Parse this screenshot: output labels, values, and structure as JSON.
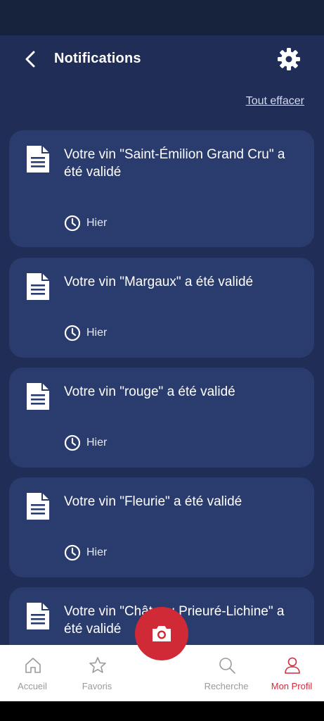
{
  "header": {
    "title": "Notifications",
    "back_icon": "chevron-left-icon",
    "settings_icon": "gear-icon"
  },
  "actions": {
    "clear_all": "Tout effacer"
  },
  "notifications": [
    {
      "message": "Votre vin \"Saint-Émilion Grand Cru\" a été validé",
      "time": "Hier",
      "icon": "document-icon"
    },
    {
      "message": "Votre vin \"Margaux\" a été validé",
      "time": "Hier",
      "icon": "document-icon"
    },
    {
      "message": "Votre vin \"rouge\" a été validé",
      "time": "Hier",
      "icon": "document-icon"
    },
    {
      "message": "Votre vin \"Fleurie\" a été validé",
      "time": "Hier",
      "icon": "document-icon"
    },
    {
      "message": "Votre vin \"Château Prieuré-Lichine\" a été validé",
      "time": "",
      "icon": "document-icon"
    }
  ],
  "bottom_nav": {
    "items": [
      {
        "label": "Accueil",
        "icon": "home-icon",
        "active": false
      },
      {
        "label": "Favoris",
        "icon": "star-icon",
        "active": false
      },
      {
        "label": "Recherche",
        "icon": "search-icon",
        "active": false
      },
      {
        "label": "Mon Profil",
        "icon": "user-icon",
        "active": true
      }
    ],
    "camera_icon": "camera-icon"
  },
  "colors": {
    "background": "#1f2d57",
    "card": "#2a3b6e",
    "accent": "#cf2a36",
    "active_nav": "#d12a3c"
  }
}
